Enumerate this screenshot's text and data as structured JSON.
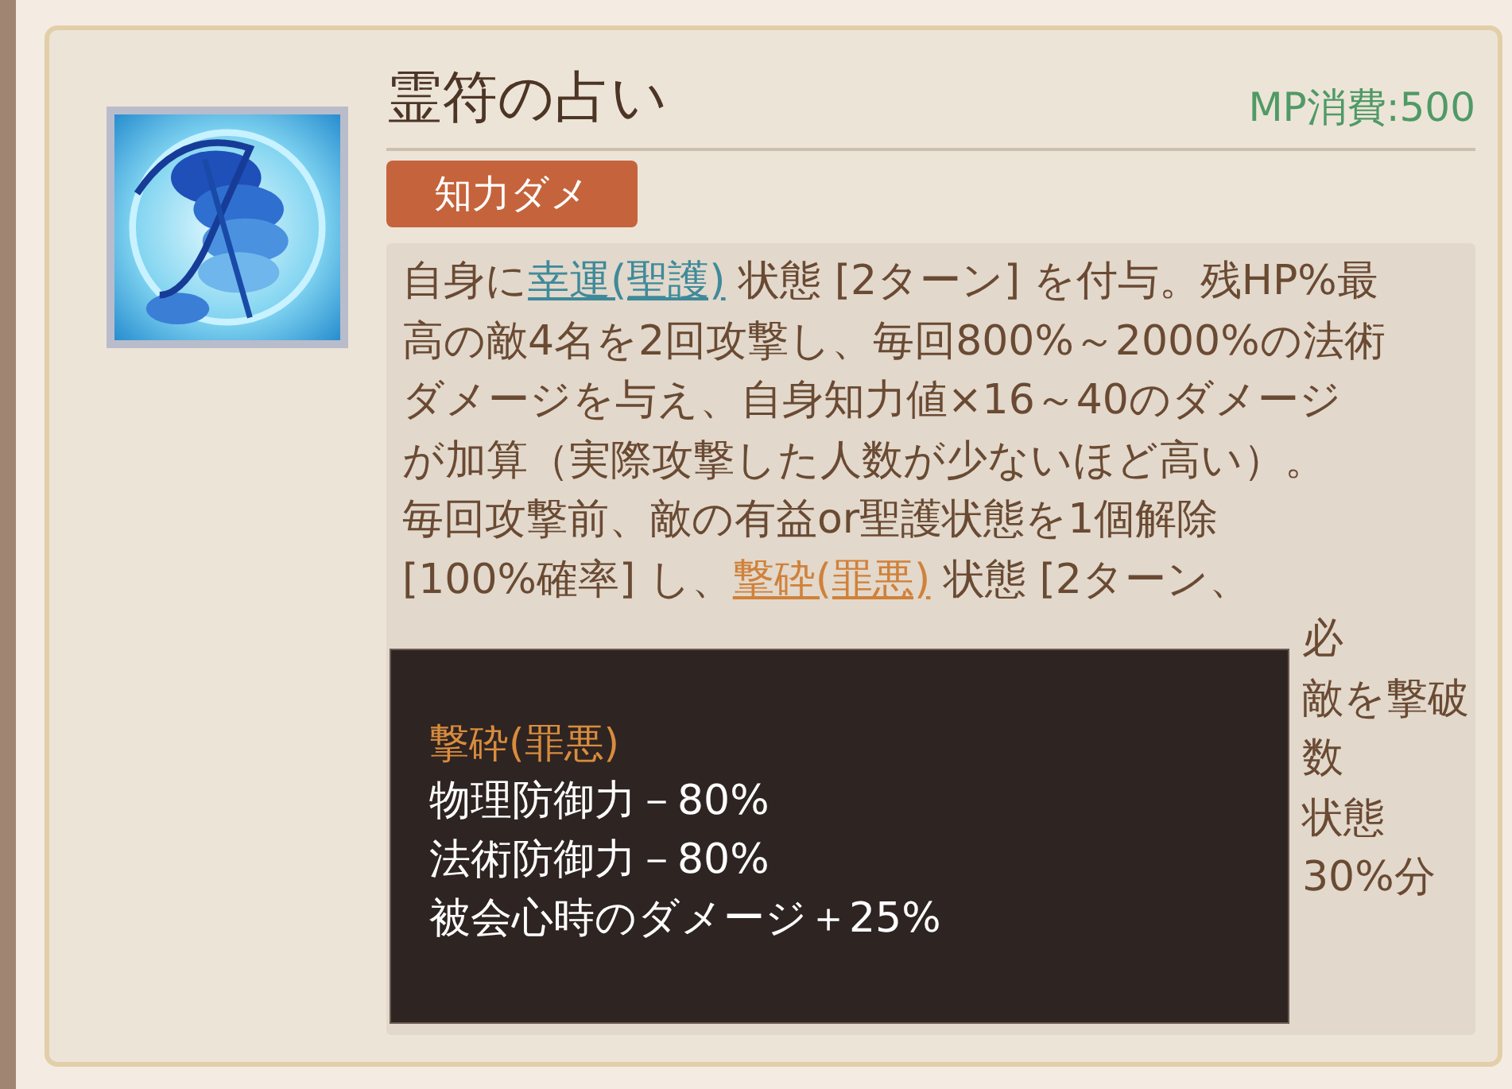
{
  "skill": {
    "name": "霊符の占い",
    "mp_cost": "MP消費:500",
    "tag": "知力ダメ",
    "icon": {
      "kind": "picture"
    },
    "description_lines": [
      [
        {
          "kind": "plain",
          "text": "自身に"
        },
        {
          "kind": "link",
          "text": "幸運(聖護)",
          "color": "#3f8a9a"
        },
        {
          "kind": "plain",
          "text": " 状態 [2ターン] を付与。残HP%最"
        }
      ],
      [
        {
          "kind": "plain",
          "text": "高の敵4名を2回攻撃し、毎回800%～2000%の法術"
        }
      ],
      [
        {
          "kind": "plain",
          "text": "ダメージを与え、自身知力値×16～40のダメージ"
        }
      ],
      [
        {
          "kind": "plain",
          "text": "が加算（実際攻撃した人数が少ないほど高い）。"
        }
      ],
      [
        {
          "kind": "plain",
          "text": "毎回攻撃前、敵の有益or聖護状態を1個解除"
        }
      ],
      [
        {
          "kind": "plain",
          "text": "[100%確率] し、"
        },
        {
          "kind": "link",
          "text": "撃砕(罪悪)",
          "color": "#d0813a"
        },
        {
          "kind": "plain",
          "text": " 状態 [2ターン、"
        }
      ]
    ],
    "covered_fragments": [
      "必",
      "敵を撃破",
      "数",
      "状態",
      "30%分"
    ]
  },
  "tooltip": {
    "title": "撃砕(罪悪)",
    "lines": [
      "物理防御力－80%",
      "法術防御力－80%",
      "被会心時のダメージ＋25%"
    ]
  }
}
